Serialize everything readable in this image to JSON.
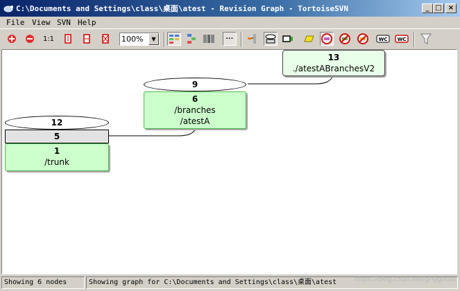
{
  "window": {
    "title": "C:\\Documents and Settings\\class\\桌面\\atest - Revision Graph - TortoiseSVN",
    "buttons": {
      "minimize": "_",
      "maximize": "□",
      "close": "×"
    }
  },
  "menu": {
    "items": [
      "File",
      "View",
      "SVN",
      "Help"
    ]
  },
  "toolbar": {
    "zoom_in_icon": "plus-circle-icon",
    "zoom_out_icon": "minus-circle-icon",
    "zoom_one_label": "1:1",
    "zoom_value": "100%",
    "more_label": "···"
  },
  "graph": {
    "nodes": [
      {
        "id": "n13",
        "rev": "13",
        "lines": [
          "./atestABranchesV2"
        ]
      },
      {
        "id": "n9",
        "rev": "9"
      },
      {
        "id": "n6",
        "rev": "6",
        "lines": [
          "/branches",
          "/atestA"
        ]
      },
      {
        "id": "n12",
        "rev": "12"
      },
      {
        "id": "n5",
        "rev": "5"
      },
      {
        "id": "n1",
        "rev": "1",
        "lines": [
          "/trunk"
        ]
      }
    ]
  },
  "status": {
    "left": "Showing 6 nodes",
    "right": "Showing graph for C:\\Documents and Settings\\class\\桌面\\atest"
  },
  "watermark": "https://blog.csdn.net/ghyghost"
}
